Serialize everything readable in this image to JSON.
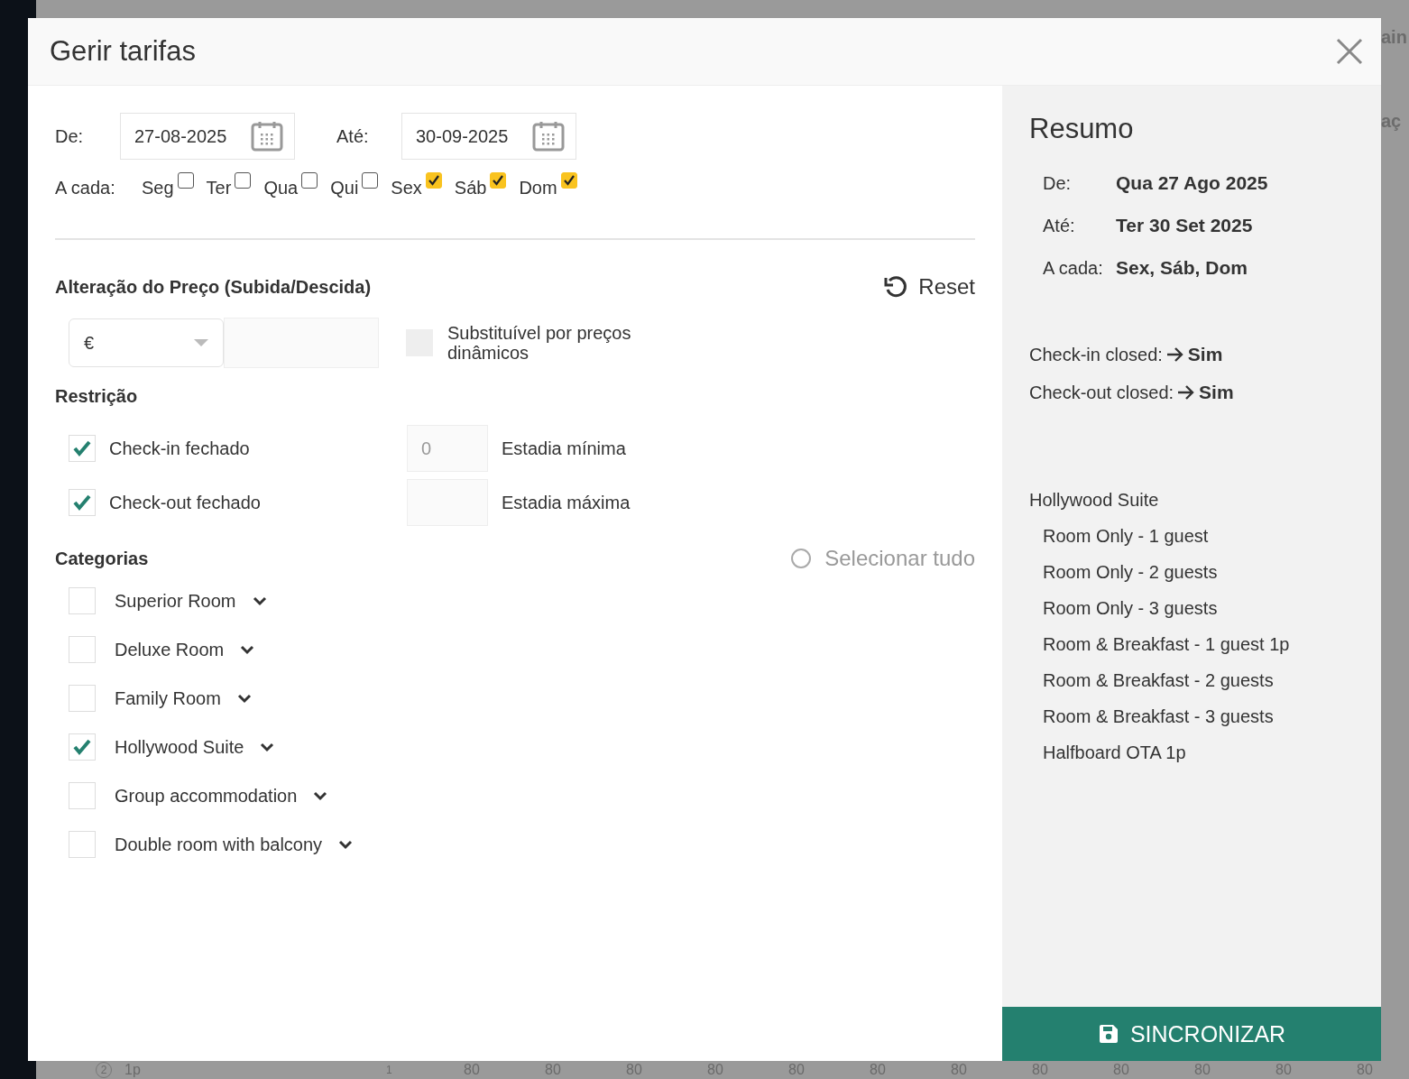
{
  "backdrop": {
    "right_fragments": [
      "ain",
      "aç"
    ],
    "bottom_row": {
      "count": "2",
      "label": "1p",
      "guests": "1",
      "cells": [
        "80",
        "80",
        "80",
        "80",
        "80",
        "80",
        "80",
        "80",
        "80",
        "80",
        "80",
        "80"
      ]
    }
  },
  "dialog": {
    "title": "Gerir tarifas"
  },
  "dates": {
    "from_label": "De:",
    "from_value": "27-08-2025",
    "to_label": "Até:",
    "to_value": "30-09-2025"
  },
  "weekdays": {
    "label": "A cada:",
    "days": [
      {
        "label": "Seg",
        "checked": false
      },
      {
        "label": "Ter",
        "checked": false
      },
      {
        "label": "Qua",
        "checked": false
      },
      {
        "label": "Qui",
        "checked": false
      },
      {
        "label": "Sex",
        "checked": true
      },
      {
        "label": "Sáb",
        "checked": true
      },
      {
        "label": "Dom",
        "checked": true
      }
    ]
  },
  "price": {
    "heading": "Alteração do Preço (Subida/Descida)",
    "reset": "Reset",
    "currency": "€",
    "dynamic_label": "Substituível por preços dinâmicos",
    "dynamic_checked": false
  },
  "restriction": {
    "heading": "Restrição",
    "items": [
      {
        "label": "Check-in fechado",
        "checked": true,
        "stay_placeholder": "0",
        "stay_label": "Estadia mínima"
      },
      {
        "label": "Check-out fechado",
        "checked": true,
        "stay_label": "Estadia máxima"
      }
    ]
  },
  "categories": {
    "heading": "Categorias",
    "select_all": "Selecionar tudo",
    "select_all_checked": false,
    "items": [
      {
        "label": "Superior Room",
        "checked": false
      },
      {
        "label": "Deluxe Room",
        "checked": false
      },
      {
        "label": "Family Room",
        "checked": false
      },
      {
        "label": "Hollywood Suite",
        "checked": true
      },
      {
        "label": "Group accommodation",
        "checked": false
      },
      {
        "label": "Double room with balcony",
        "checked": false
      }
    ]
  },
  "summary": {
    "title": "Resumo",
    "rows": [
      {
        "label": "De:",
        "value": "Qua 27 Ago 2025"
      },
      {
        "label": "Até:",
        "value": "Ter 30 Set 2025"
      },
      {
        "label": "A cada:",
        "value": "Sex, Sáb, Dom"
      }
    ],
    "flags": [
      {
        "label": "Check-in closed:",
        "value": "Sim"
      },
      {
        "label": "Check-out closed:",
        "value": "Sim"
      }
    ],
    "category": "Hollywood Suite",
    "rates": [
      "Room Only - 1 guest",
      "Room Only - 2 guests",
      "Room Only - 3 guests",
      "Room & Breakfast - 1 guest 1p",
      "Room & Breakfast - 2 guests",
      "Room & Breakfast - 3 guests",
      "Halfboard OTA 1p"
    ]
  },
  "sync_button": "SINCRONIZAR"
}
